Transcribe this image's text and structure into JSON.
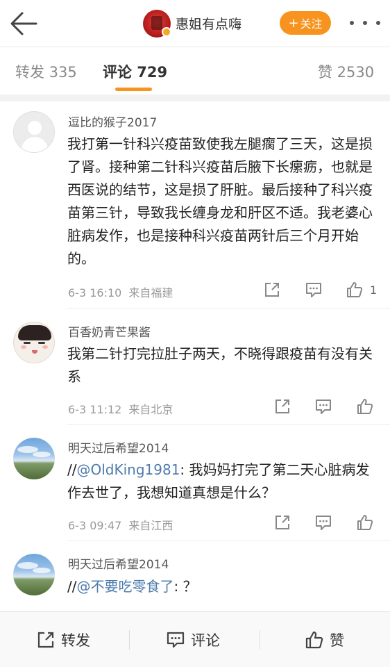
{
  "header": {
    "back_icon": "back-arrow-icon",
    "account_name": "惠姐有点嗨",
    "follow_label": "关注",
    "follow_plus": "+",
    "more_icon": "more-dots-icon",
    "accent_color": "#f7931e"
  },
  "tabs": {
    "forward": "转发 335",
    "comment": "评论 729",
    "like": "赞 2530"
  },
  "comments": [
    {
      "user": "逗比的猴子2017",
      "avatar": "default-avatar",
      "text": "我打第一针科兴疫苗致使我左腿瘸了三天，这是损了肾。接种第二针科兴疫苗后腋下长瘰疬，也就是西医说的结节，这是损了肝脏。最后接种了科兴疫苗第三针，导致我长缠身龙和肝区不适。我老婆心脏病发作，也是接种科兴疫苗两针后三个月开始的。",
      "time": "6-3 16:10",
      "location": "来自福建",
      "likes": "1"
    },
    {
      "user": "百香奶青芒果酱",
      "avatar": "cartoon-face-avatar",
      "text": "我第二针打完拉肚子两天，不晓得跟疫苗有没有关系",
      "time": "6-3 11:12",
      "location": "来自北京",
      "likes": ""
    },
    {
      "user": "明天过后希望2014",
      "avatar": "sky-landscape-avatar",
      "prefix": "//",
      "mention": "@OldKing1981",
      "text": ": 我妈妈打完了第二天心脏病发作去世了，我想知道真想是什么？",
      "time": "6-3 09:47",
      "location": "来自江西",
      "likes": ""
    },
    {
      "user": "明天过后希望2014",
      "avatar": "sky-landscape-avatar",
      "prefix": "//",
      "mention": "@不要吃零食了",
      "text": ": ？"
    }
  ],
  "bottom_bar": {
    "forward": "转发",
    "comment": "评论",
    "like": "赞"
  }
}
